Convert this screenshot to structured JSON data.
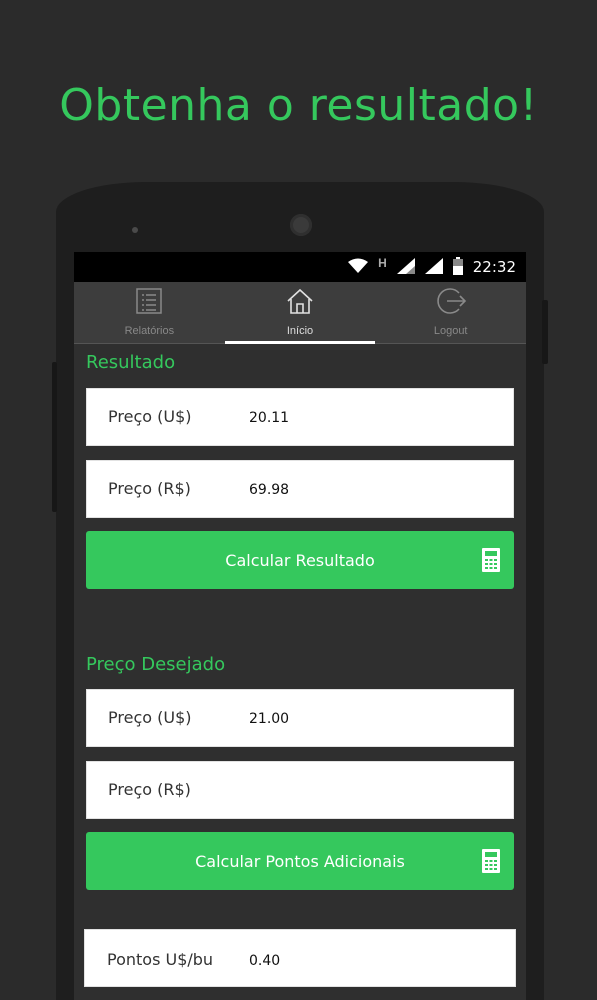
{
  "headline": "Obtenha o resultado!",
  "status_bar": {
    "network_letter": "H",
    "time": "22:32"
  },
  "tabs": [
    {
      "label": "Relatórios",
      "icon": "list-icon",
      "active": false
    },
    {
      "label": "Início",
      "icon": "home-icon",
      "active": true
    },
    {
      "label": "Logout",
      "icon": "logout-icon",
      "active": false
    }
  ],
  "resultado": {
    "title": "Resultado",
    "price_usd": {
      "label": "Preço (U$)",
      "value": "20.11"
    },
    "price_brl": {
      "label": "Preço (R$)",
      "value": "69.98"
    },
    "button_label": "Calcular Resultado"
  },
  "preco_desejado": {
    "title": "Preço Desejado",
    "price_usd": {
      "label": "Preço (U$)",
      "value": "21.00"
    },
    "price_brl": {
      "label": "Preço (R$)",
      "value": ""
    },
    "button_label": "Calcular Pontos Adicionais"
  },
  "pontos": {
    "label": "Pontos U$/bu",
    "value": "0.40"
  },
  "colors": {
    "accent": "#35c85d",
    "background": "#2b2b2b"
  }
}
